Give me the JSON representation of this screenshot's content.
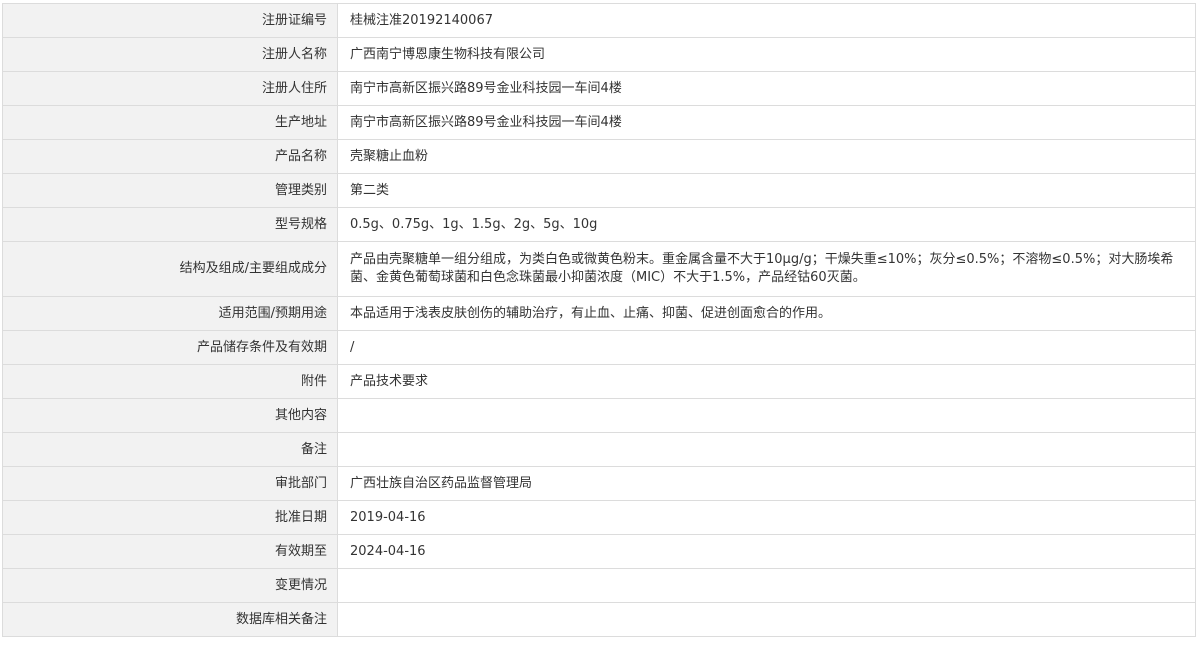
{
  "rows": [
    {
      "label": "注册证编号",
      "value": "桂械注准20192140067"
    },
    {
      "label": "注册人名称",
      "value": "广西南宁博恩康生物科技有限公司"
    },
    {
      "label": "注册人住所",
      "value": "南宁市高新区振兴路89号金业科技园一车间4楼"
    },
    {
      "label": "生产地址",
      "value": "南宁市高新区振兴路89号金业科技园一车间4楼"
    },
    {
      "label": "产品名称",
      "value": "壳聚糖止血粉"
    },
    {
      "label": "管理类别",
      "value": "第二类"
    },
    {
      "label": "型号规格",
      "value": "0.5g、0.75g、1g、1.5g、2g、5g、10g"
    },
    {
      "label": "结构及组成/主要组成成分",
      "value": "产品由壳聚糖单一组分组成，为类白色或微黄色粉末。重金属含量不大于10μg/g；干燥失重≤10%；灰分≤0.5%；不溶物≤0.5%；对大肠埃希菌、金黄色葡萄球菌和白色念珠菌最小抑菌浓度（MIC）不大于1.5%，产品经钴60灭菌。"
    },
    {
      "label": "适用范围/预期用途",
      "value": "本品适用于浅表皮肤创伤的辅助治疗，有止血、止痛、抑菌、促进创面愈合的作用。"
    },
    {
      "label": "产品储存条件及有效期",
      "value": "/"
    },
    {
      "label": "附件",
      "value": "产品技术要求"
    },
    {
      "label": "其他内容",
      "value": ""
    },
    {
      "label": "备注",
      "value": ""
    },
    {
      "label": "审批部门",
      "value": "广西壮族自治区药品监督管理局"
    },
    {
      "label": "批准日期",
      "value": "2019-04-16"
    },
    {
      "label": "有效期至",
      "value": "2024-04-16"
    },
    {
      "label": "变更情况",
      "value": ""
    },
    {
      "label": "数据库相关备注",
      "value": ""
    }
  ]
}
